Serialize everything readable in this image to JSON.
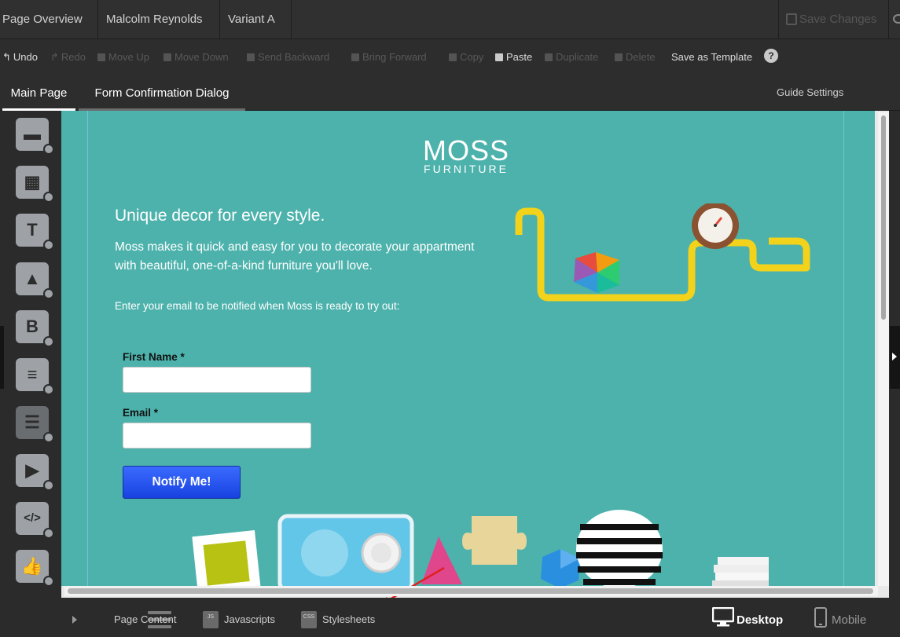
{
  "topbar": {
    "page_overview": "Page Overview",
    "user": "Malcolm Reynolds",
    "variant": "Variant A",
    "save_changes": "Save Changes"
  },
  "toolbar": {
    "undo": "Undo",
    "redo": "Redo",
    "move_up": "Move Up",
    "move_down": "Move Down",
    "send_backward": "Send Backward",
    "bring_forward": "Bring Forward",
    "copy": "Copy",
    "paste": "Paste",
    "duplicate": "Duplicate",
    "delete": "Delete",
    "save_as_template": "Save as Template",
    "help": "?"
  },
  "tabs": {
    "main_page": "Main Page",
    "form_confirmation": "Form Confirmation Dialog",
    "guide_settings": "Guide Settings"
  },
  "sidebar_tools": [
    {
      "name": "section",
      "glyph": "▬"
    },
    {
      "name": "box",
      "glyph": "▦"
    },
    {
      "name": "text",
      "glyph": "T"
    },
    {
      "name": "image",
      "glyph": "▲"
    },
    {
      "name": "button",
      "glyph": "B"
    },
    {
      "name": "form",
      "glyph": "≡"
    },
    {
      "name": "list",
      "glyph": "☰"
    },
    {
      "name": "video",
      "glyph": "▶"
    },
    {
      "name": "custom-html",
      "glyph": "</>"
    },
    {
      "name": "social",
      "glyph": "👍"
    }
  ],
  "landing_page": {
    "logo": "MOSS",
    "logo_sub": "FURNITURE",
    "headline": "Unique decor for every style.",
    "body": "Moss makes it quick and easy for you to decorate your appartment with beautiful, one-of-a-kind furniture you'll love.",
    "cta_text": "Enter your email to be notified when Moss is ready to try out:",
    "first_name_label": "First Name *",
    "email_label": "Email *",
    "notify_button": "Notify Me!"
  },
  "bottombar": {
    "page_content": "Page Content",
    "javascripts": "Javascripts",
    "stylesheets": "Stylesheets",
    "desktop": "Desktop",
    "mobile": "Mobile",
    "js_badge": "JS",
    "css_badge": "CSS"
  },
  "colors": {
    "canvas_bg": "#4db2ac",
    "notify_button": "#1f4ff0",
    "annotation_arrow": "#e02020"
  }
}
